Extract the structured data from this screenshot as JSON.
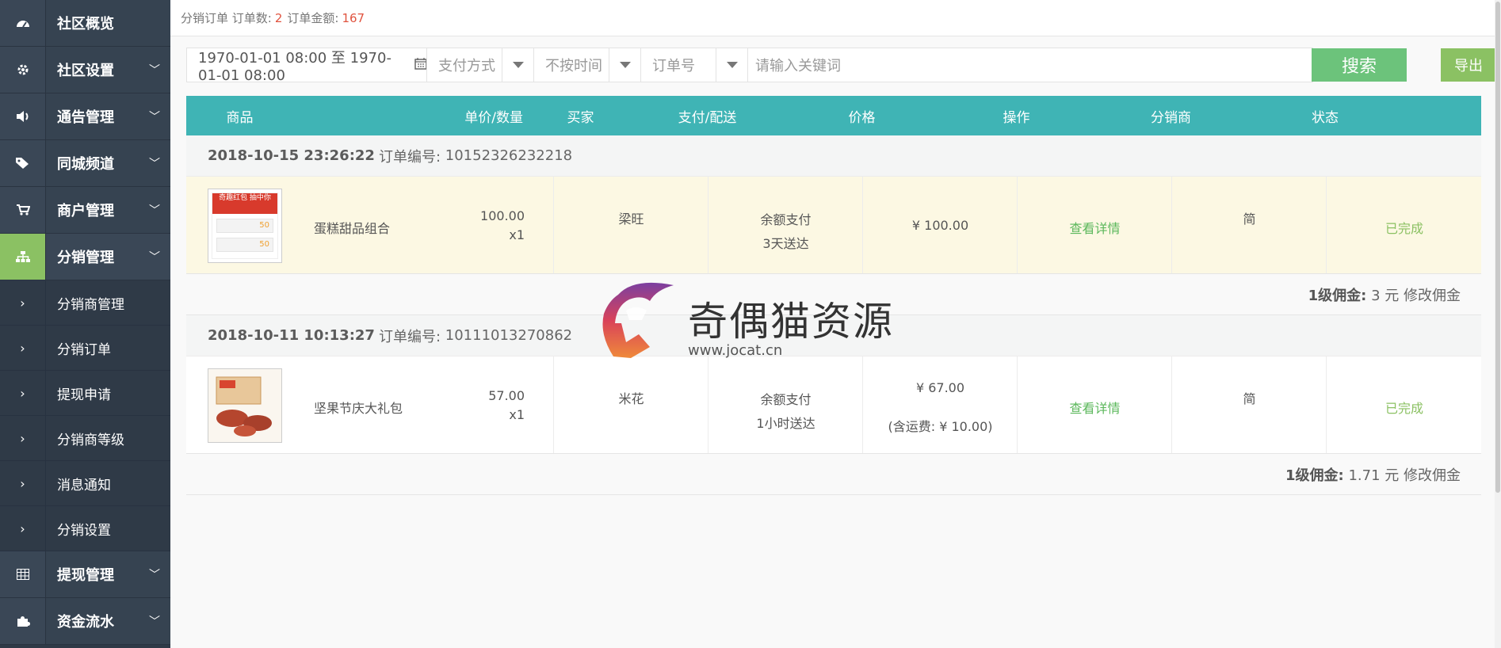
{
  "sidebar": {
    "items": [
      {
        "label": "社区概览",
        "icon": "dashboard-icon",
        "glyph": "◷",
        "chevron": false
      },
      {
        "label": "社区设置",
        "icon": "gear-icon",
        "glyph": "✲",
        "chevron": true
      },
      {
        "label": "通告管理",
        "icon": "megaphone-icon",
        "glyph": "🔊",
        "chevron": true
      },
      {
        "label": "同城频道",
        "icon": "tags-icon",
        "glyph": "⛉",
        "chevron": true
      },
      {
        "label": "商户管理",
        "icon": "cart-icon",
        "glyph": "🛒",
        "chevron": true
      },
      {
        "label": "分销管理",
        "icon": "sitemap-icon",
        "glyph": "品",
        "chevron": true,
        "active": true
      }
    ],
    "sub_items": [
      {
        "label": "分销商管理"
      },
      {
        "label": "分销订单"
      },
      {
        "label": "提现申请"
      },
      {
        "label": "分销商等级"
      },
      {
        "label": "消息通知"
      },
      {
        "label": "分销设置"
      }
    ],
    "bottom_items": [
      {
        "label": "提现管理",
        "icon": "table-icon",
        "glyph": "▦",
        "chevron": true
      },
      {
        "label": "资金流水",
        "icon": "puzzle-icon",
        "glyph": "✚",
        "chevron": true
      }
    ]
  },
  "topbar": {
    "title": "分销订单",
    "count_label": "订单数:",
    "count": "2",
    "amount_label": "订单金额:",
    "amount": "167"
  },
  "filter": {
    "date_range": "1970-01-01 08:00 至 1970-01-01 08:00",
    "payment_select": "支付方式",
    "time_select": "不按时间",
    "field_select": "订单号",
    "keyword_placeholder": "请输入关键词",
    "search_label": "搜索",
    "export_label": "导出"
  },
  "table": {
    "headers": [
      "商品",
      "单价/数量",
      "买家",
      "支付/配送",
      "价格",
      "操作",
      "分销商",
      "状态"
    ]
  },
  "orders": [
    {
      "date": "2018-10-15 23:26:22",
      "order_no_label": "订单编号:",
      "order_no": "10152326232218",
      "product": "蛋糕甜品组合",
      "unit_price": "100.00",
      "qty": "x1",
      "buyer": "梁旺",
      "payment": "余额支付",
      "delivery": "3天送达",
      "price": "¥ 100.00",
      "shipping": "",
      "action": "查看详情",
      "distributor": "简",
      "status": "已完成",
      "commission_label": "1级佣金:",
      "commission_value": "3 元",
      "commission_edit": "修改佣金",
      "thumb_text": "奇趣红包 抽中你"
    },
    {
      "date": "2018-10-11 10:13:27",
      "order_no_label": "订单编号:",
      "order_no": "10111013270862",
      "product": "坚果节庆大礼包",
      "unit_price": "57.00",
      "qty": "x1",
      "buyer": "米花",
      "payment": "余额支付",
      "delivery": "1小时送达",
      "price": "¥ 67.00",
      "shipping": "(含运费: ¥ 10.00)",
      "action": "查看详情",
      "distributor": "简",
      "status": "已完成",
      "commission_label": "1级佣金:",
      "commission_value": "1.71 元",
      "commission_edit": "修改佣金",
      "thumb_text": ""
    }
  ],
  "watermark": {
    "brand": "奇偶猫资源",
    "url": "www.jocat.cn"
  },
  "colors": {
    "sidebar_bg": "#2f3a47",
    "active_accent": "#8bc163",
    "table_header": "#3fb4b5",
    "search_button": "#6cc37b",
    "export_button": "#8bc163",
    "count_red": "#e0533f",
    "highlight_row": "#fcf8e3",
    "link_green": "#5cb85c"
  }
}
